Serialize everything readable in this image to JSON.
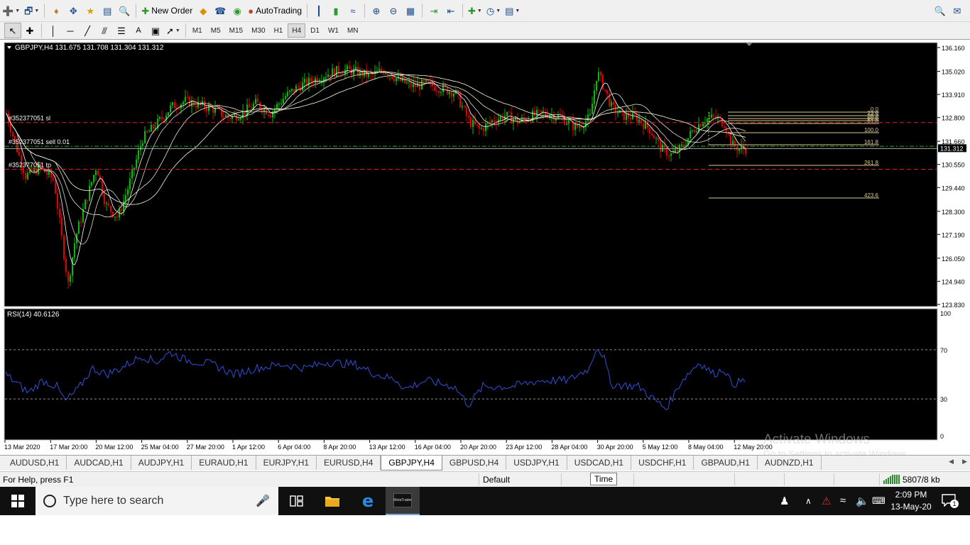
{
  "toolbar": {
    "new_order_label": "New Order",
    "autotrading_label": "AutoTrading",
    "timeframes": [
      "M1",
      "M5",
      "M15",
      "M30",
      "H1",
      "H4",
      "D1",
      "W1",
      "MN"
    ],
    "active_timeframe": "H4"
  },
  "chart": {
    "header": "GBPJPY,H4  131.675 131.708 131.304 131.312",
    "price_axis": [
      "136.160",
      "135.020",
      "133.910",
      "132.800",
      "131.660",
      "130.550",
      "129.440",
      "128.300",
      "127.190",
      "126.050",
      "124.940",
      "123.830"
    ],
    "current_price": "131.312",
    "time_axis": [
      "13 Mar 2020",
      "17 Mar 20:00",
      "20 Mar 12:00",
      "25 Mar 04:00",
      "27 Mar 20:00",
      "1 Apr 12:00",
      "6 Apr 04:00",
      "8 Apr 20:00",
      "13 Apr 12:00",
      "16 Apr 04:00",
      "20 Apr 20:00",
      "23 Apr 12:00",
      "28 Apr 04:00",
      "30 Apr 20:00",
      "5 May 12:00",
      "8 May 04:00",
      "12 May 20:00"
    ],
    "order_labels": {
      "sl": "#352377051 sl",
      "entry": "#352377051 sell 0.01",
      "tp": "#352377051 tp"
    },
    "fib_levels": [
      "0.0",
      "23.6",
      "38.2",
      "50.0",
      "61.8",
      "100.0",
      "161.8",
      "261.8",
      "423.6"
    ],
    "colors": {
      "background": "#000000",
      "bull_candle": "#00c000",
      "bear_candle": "#e00000",
      "sl_tp_line": "#e02020",
      "entry_line": "#20b020",
      "fib": "#d8c890",
      "rsi_line": "#3050d8"
    }
  },
  "rsi": {
    "header": "RSI(14) 40.6126",
    "axis": [
      "100",
      "70",
      "30",
      "0"
    ]
  },
  "tabs": [
    "AUDUSD,H1",
    "AUDCAD,H1",
    "AUDJPY,H1",
    "EURAUD,H1",
    "EURJPY,H1",
    "EURUSD,H4",
    "GBPJPY,H4",
    "GBPUSD,H4",
    "USDJPY,H1",
    "USDCAD,H1",
    "USDCHF,H1",
    "GBPAUD,H1",
    "AUDNZD,H1"
  ],
  "active_tab": "GBPJPY,H4",
  "statusbar": {
    "help": "For Help, press F1",
    "profile": "Default",
    "tooltip": "Time",
    "connection": "5807/8 kb"
  },
  "watermark": {
    "line1": "Activate Windows",
    "line2": "Go to Settings to activate Windows."
  },
  "taskbar": {
    "search_placeholder": "Type here to search",
    "time": "2:09 PM",
    "date": "13-May-20",
    "notification_count": "1",
    "app_label": "MetaTrader"
  }
}
